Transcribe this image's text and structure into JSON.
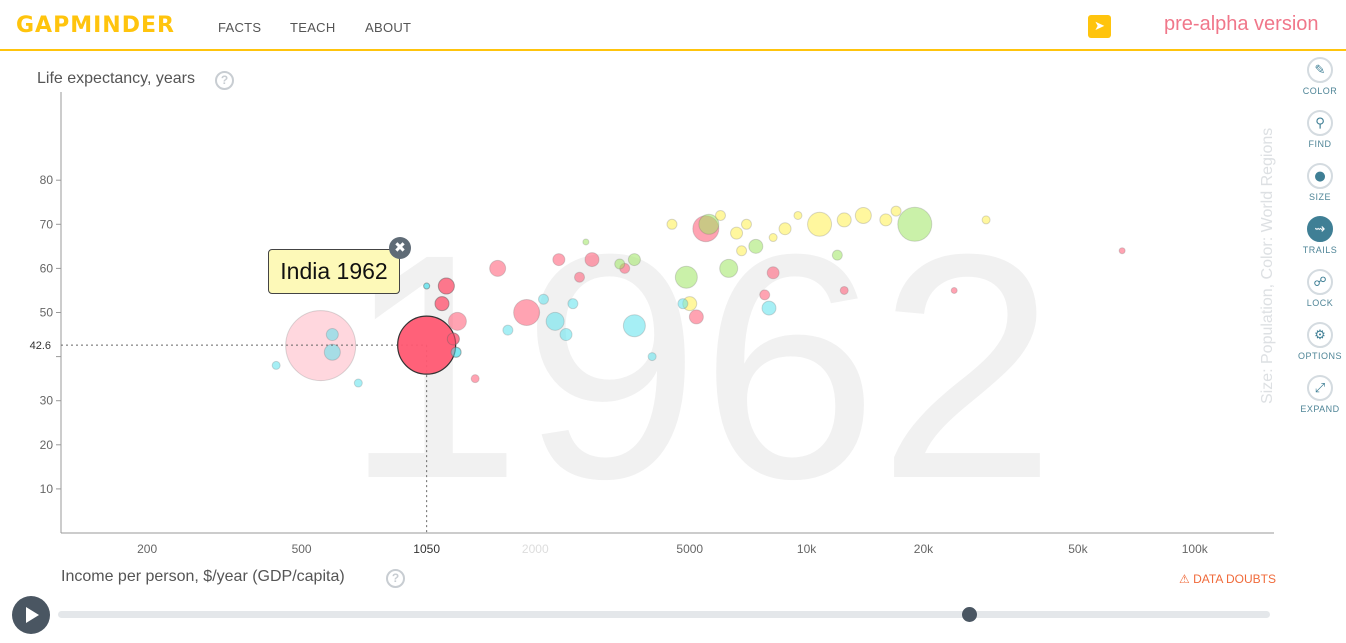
{
  "header": {
    "logo": "GAPMINDER",
    "nav": [
      "FACTS",
      "TEACH",
      "ABOUT"
    ],
    "share_icon": "paper-plane-icon",
    "version": "pre-alpha version"
  },
  "axes": {
    "y_title": "Life expectancy, years",
    "x_title": "Income per person, $/year (GDP/capita)",
    "size_color_label": "Size: Population, Color: World Regions"
  },
  "tooltip": {
    "text": "India 1962",
    "close_icon": "close-icon"
  },
  "toolbar": [
    {
      "label": "COLOR",
      "icon": "paint-brush-icon"
    },
    {
      "label": "FIND",
      "icon": "search-icon"
    },
    {
      "label": "SIZE",
      "icon": "circle-icon"
    },
    {
      "label": "TRAILS",
      "icon": "trails-icon",
      "active": true
    },
    {
      "label": "LOCK",
      "icon": "unlock-icon"
    },
    {
      "label": "OPTIONS",
      "icon": "gear-icon"
    },
    {
      "label": "EXPAND",
      "icon": "expand-icon"
    }
  ],
  "data_doubts": "DATA DOUBTS",
  "timeline": {
    "year": 1962,
    "position": 0.752,
    "play_icon": "play-icon"
  },
  "colors": {
    "accent": "#ffc40d",
    "version": "#f0778a",
    "asia": "#ff5872",
    "asia_light": "#ffb6c3",
    "africa": "#5ce2ec",
    "americas": "#9ee662",
    "europe": "#fff04f",
    "highlight_stroke": "#333333"
  },
  "chart_data": {
    "type": "scatter",
    "title": "1962",
    "xlabel": "Income per person, $/year (GDP/capita)",
    "ylabel": "Life expectancy, years",
    "x_scale": "log",
    "xlim": [
      120,
      160000
    ],
    "ylim": [
      0,
      100
    ],
    "x_ticks": [
      200,
      500,
      1050,
      2000,
      5000,
      10000,
      20000,
      50000,
      100000
    ],
    "x_tick_labels": [
      "200",
      "500",
      "1050",
      "2000",
      "5000",
      "10k",
      "20k",
      "50k",
      "100k"
    ],
    "y_ticks": [
      10,
      20,
      30,
      40,
      50,
      60,
      70,
      80
    ],
    "y_tick_labels": [
      "10",
      "20",
      "30",
      "",
      "50",
      "60",
      "70",
      "80"
    ],
    "highlight": {
      "name": "India",
      "x": 1050,
      "y": 42.6,
      "x_label": "1050",
      "y_label": "42.6"
    },
    "points": [
      {
        "x": 1050,
        "y": 42.6,
        "r": 29,
        "region": "asia",
        "highlight": true
      },
      {
        "x": 560,
        "y": 42.5,
        "r": 35,
        "region": "asia_light"
      },
      {
        "x": 1180,
        "y": 56,
        "r": 8,
        "region": "asia"
      },
      {
        "x": 1150,
        "y": 52,
        "r": 7,
        "region": "asia"
      },
      {
        "x": 1260,
        "y": 48,
        "r": 9,
        "region": "asia"
      },
      {
        "x": 1230,
        "y": 44,
        "r": 6,
        "region": "asia"
      },
      {
        "x": 1600,
        "y": 60,
        "r": 8,
        "region": "asia"
      },
      {
        "x": 1900,
        "y": 50,
        "r": 13,
        "region": "asia"
      },
      {
        "x": 2300,
        "y": 62,
        "r": 6,
        "region": "asia"
      },
      {
        "x": 2600,
        "y": 58,
        "r": 5,
        "region": "asia"
      },
      {
        "x": 2800,
        "y": 62,
        "r": 7,
        "region": "asia"
      },
      {
        "x": 3400,
        "y": 60,
        "r": 5,
        "region": "asia"
      },
      {
        "x": 5500,
        "y": 69,
        "r": 13,
        "region": "asia"
      },
      {
        "x": 5200,
        "y": 49,
        "r": 7,
        "region": "asia"
      },
      {
        "x": 7800,
        "y": 54,
        "r": 5,
        "region": "asia"
      },
      {
        "x": 8200,
        "y": 59,
        "r": 6,
        "region": "asia"
      },
      {
        "x": 12500,
        "y": 55,
        "r": 4,
        "region": "asia"
      },
      {
        "x": 24000,
        "y": 55,
        "r": 3,
        "region": "asia"
      },
      {
        "x": 65000,
        "y": 64,
        "r": 3,
        "region": "asia"
      },
      {
        "x": 1400,
        "y": 35,
        "r": 4,
        "region": "asia"
      },
      {
        "x": 600,
        "y": 45,
        "r": 6,
        "region": "africa"
      },
      {
        "x": 600,
        "y": 41,
        "r": 8,
        "region": "africa"
      },
      {
        "x": 700,
        "y": 34,
        "r": 4,
        "region": "africa"
      },
      {
        "x": 430,
        "y": 38,
        "r": 4,
        "region": "africa"
      },
      {
        "x": 1250,
        "y": 41,
        "r": 5,
        "region": "africa"
      },
      {
        "x": 1700,
        "y": 46,
        "r": 5,
        "region": "africa"
      },
      {
        "x": 2100,
        "y": 53,
        "r": 5,
        "region": "africa"
      },
      {
        "x": 2250,
        "y": 48,
        "r": 9,
        "region": "africa"
      },
      {
        "x": 2400,
        "y": 45,
        "r": 6,
        "region": "africa"
      },
      {
        "x": 2500,
        "y": 52,
        "r": 5,
        "region": "africa"
      },
      {
        "x": 3600,
        "y": 47,
        "r": 11,
        "region": "africa"
      },
      {
        "x": 4000,
        "y": 40,
        "r": 4,
        "region": "africa"
      },
      {
        "x": 8000,
        "y": 51,
        "r": 7,
        "region": "africa"
      },
      {
        "x": 4800,
        "y": 52,
        "r": 5,
        "region": "africa"
      },
      {
        "x": 1050,
        "y": 56,
        "r": 3,
        "region": "africa"
      },
      {
        "x": 5600,
        "y": 70,
        "r": 10,
        "region": "americas"
      },
      {
        "x": 4900,
        "y": 58,
        "r": 11,
        "region": "americas"
      },
      {
        "x": 6300,
        "y": 60,
        "r": 9,
        "region": "americas"
      },
      {
        "x": 7400,
        "y": 65,
        "r": 7,
        "region": "americas"
      },
      {
        "x": 3600,
        "y": 62,
        "r": 6,
        "region": "americas"
      },
      {
        "x": 12000,
        "y": 63,
        "r": 5,
        "region": "americas"
      },
      {
        "x": 19000,
        "y": 70,
        "r": 17,
        "region": "americas"
      },
      {
        "x": 2700,
        "y": 66,
        "r": 3,
        "region": "americas"
      },
      {
        "x": 3300,
        "y": 61,
        "r": 5,
        "region": "americas"
      },
      {
        "x": 6000,
        "y": 72,
        "r": 5,
        "region": "europe"
      },
      {
        "x": 6600,
        "y": 68,
        "r": 6,
        "region": "europe"
      },
      {
        "x": 7000,
        "y": 70,
        "r": 5,
        "region": "europe"
      },
      {
        "x": 8800,
        "y": 69,
        "r": 6,
        "region": "europe"
      },
      {
        "x": 10800,
        "y": 70,
        "r": 12,
        "region": "europe"
      },
      {
        "x": 12500,
        "y": 71,
        "r": 7,
        "region": "europe"
      },
      {
        "x": 14000,
        "y": 72,
        "r": 8,
        "region": "europe"
      },
      {
        "x": 16000,
        "y": 71,
        "r": 6,
        "region": "europe"
      },
      {
        "x": 6800,
        "y": 64,
        "r": 5,
        "region": "europe"
      },
      {
        "x": 4500,
        "y": 70,
        "r": 5,
        "region": "europe"
      },
      {
        "x": 5000,
        "y": 52,
        "r": 7,
        "region": "europe"
      },
      {
        "x": 9500,
        "y": 72,
        "r": 4,
        "region": "europe"
      },
      {
        "x": 29000,
        "y": 71,
        "r": 4,
        "region": "europe"
      },
      {
        "x": 17000,
        "y": 73,
        "r": 5,
        "region": "europe"
      },
      {
        "x": 8200,
        "y": 67,
        "r": 4,
        "region": "europe"
      }
    ]
  }
}
